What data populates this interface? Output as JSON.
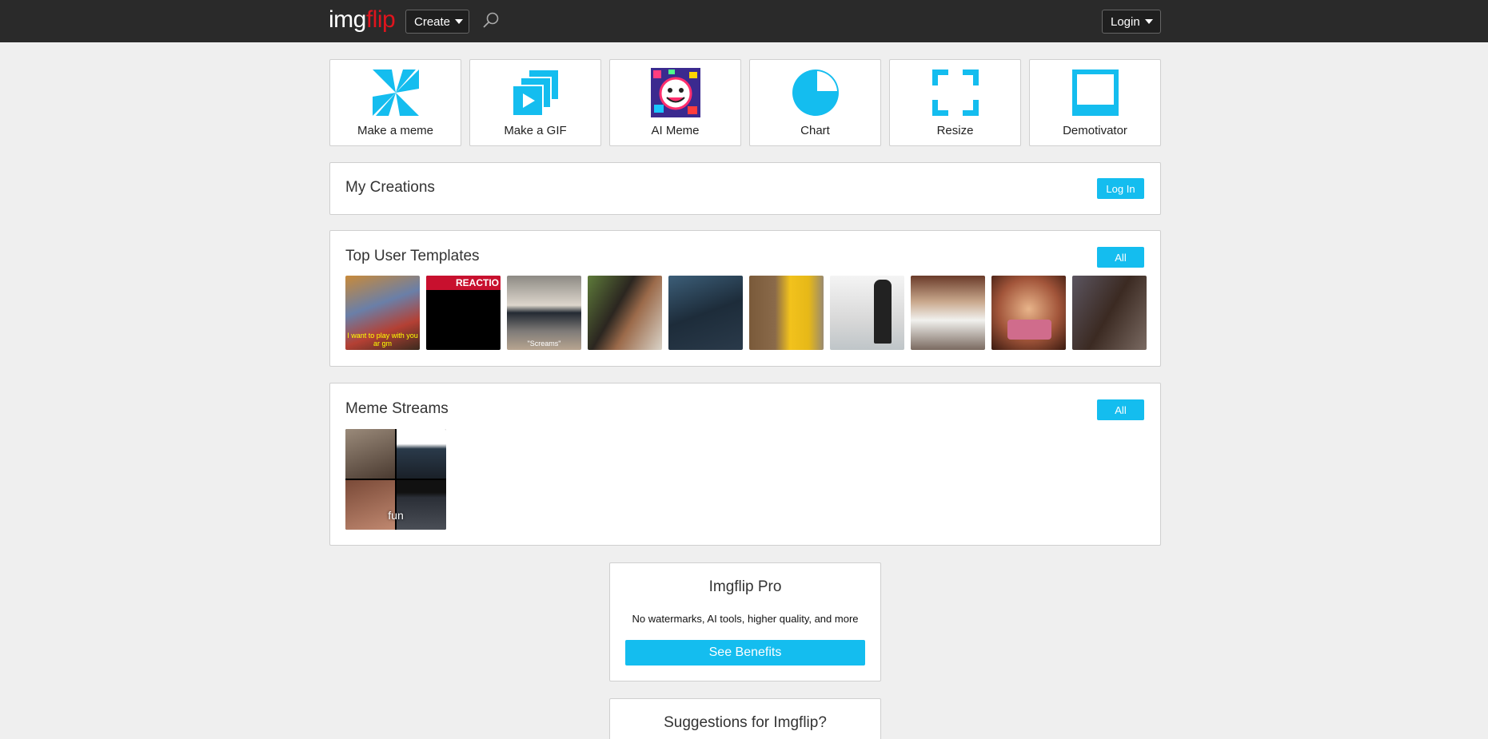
{
  "header": {
    "logo_part1": "img",
    "logo_part2": "flip",
    "create_label": "Create",
    "login_label": "Login",
    "search_icon": "search-icon"
  },
  "tools": [
    {
      "label": "Make a meme",
      "icon": "pinwheel-icon"
    },
    {
      "label": "Make a GIF",
      "icon": "gif-stack-icon"
    },
    {
      "label": "AI Meme",
      "icon": "ai-meme-icon"
    },
    {
      "label": "Chart",
      "icon": "pie-chart-icon"
    },
    {
      "label": "Resize",
      "icon": "resize-corners-icon"
    },
    {
      "label": "Demotivator",
      "icon": "demotivator-frame-icon"
    }
  ],
  "my_creations": {
    "title": "My Creations",
    "button": "Log In"
  },
  "top_templates": {
    "title": "Top User Templates",
    "button": "All",
    "items": [
      {
        "caption": "I want to play with you ar gm"
      },
      {
        "caption": "REACTIO"
      },
      {
        "caption": "\"Screams\""
      },
      {
        "caption": ""
      },
      {
        "caption": ""
      },
      {
        "caption": ""
      },
      {
        "caption": ""
      },
      {
        "caption": ""
      },
      {
        "caption": ""
      },
      {
        "caption": ""
      }
    ]
  },
  "meme_streams": {
    "title": "Meme Streams",
    "button": "All",
    "stream_label": "fun"
  },
  "pro": {
    "title": "Imgflip Pro",
    "text": "No watermarks, AI tools, higher quality, and more",
    "button": "See Benefits"
  },
  "suggestions": {
    "title": "Suggestions for Imgflip?"
  },
  "colors": {
    "accent": "#14bdef",
    "header": "#2a2a2a",
    "logo_red": "#e0141d"
  }
}
